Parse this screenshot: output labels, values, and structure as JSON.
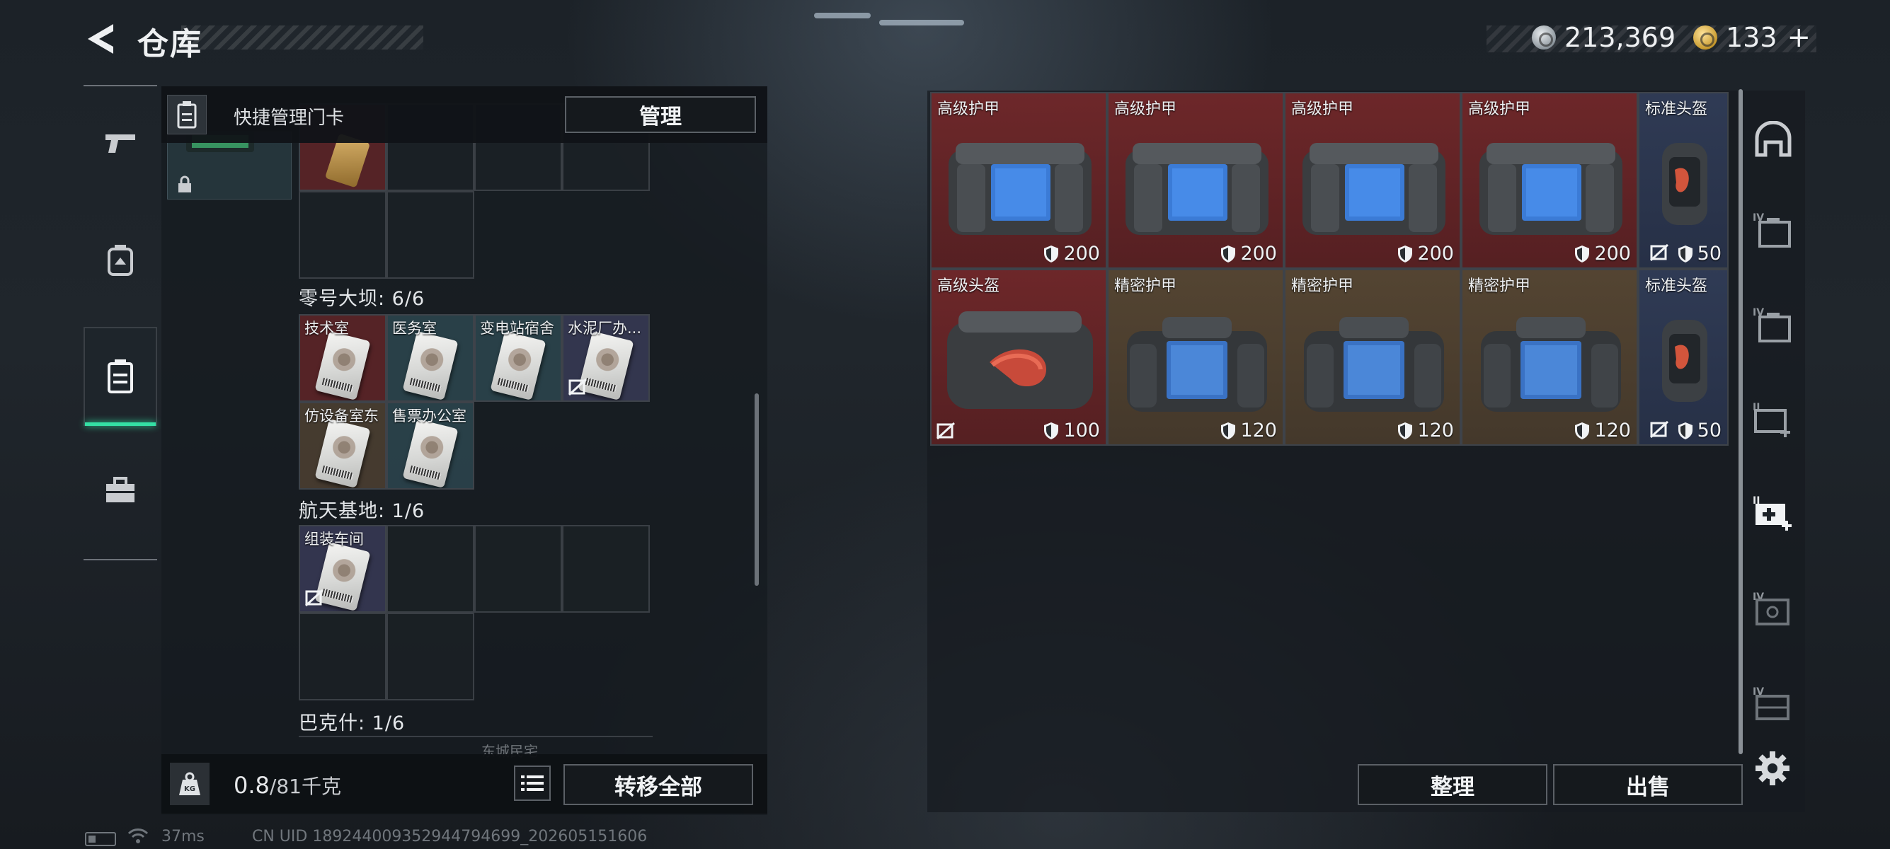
{
  "header": {
    "title": "仓库",
    "currency_silver": "213,369",
    "currency_gold": "133",
    "currency_gold_plus": "+"
  },
  "left_rail": {
    "items": [
      {
        "icon": "pistol-icon"
      },
      {
        "icon": "backpack-icon"
      },
      {
        "icon": "keycard-holder-icon",
        "active": true
      },
      {
        "icon": "toolbox-icon"
      }
    ],
    "accent": "#34e0a4"
  },
  "keycards": {
    "header_label": "快捷管理门卡",
    "manage_label": "管理",
    "sections": [
      {
        "title": "零号大坝: 6/6",
        "cards": [
          {
            "name": "技术室",
            "color": "red",
            "bound": false
          },
          {
            "name": "医务室",
            "color": "teal",
            "bound": false
          },
          {
            "name": "变电站宿舍",
            "color": "teal",
            "bound": false
          },
          {
            "name": "水泥厂办...",
            "color": "purple",
            "bound": true
          },
          {
            "name": "仿设备室东",
            "color": "brown",
            "bound": false
          },
          {
            "name": "售票办公室",
            "color": "teal",
            "bound": false
          }
        ]
      },
      {
        "title": "航天基地: 1/6",
        "cards": [
          {
            "name": "组装车间",
            "color": "purple",
            "bound": true
          }
        ]
      },
      {
        "title": "巴克什: 1/6",
        "cards": []
      }
    ],
    "next_section_peek": "东城民宅",
    "weight_current": "0.8",
    "weight_max": "/81千克",
    "transfer_all_label": "转移全部"
  },
  "stash": {
    "items": [
      {
        "name": "高级护甲",
        "value": "200",
        "rarity": "red",
        "type": "armor",
        "bound": false
      },
      {
        "name": "高级护甲",
        "value": "200",
        "rarity": "red",
        "type": "armor",
        "bound": false
      },
      {
        "name": "高级护甲",
        "value": "200",
        "rarity": "red",
        "type": "armor",
        "bound": false
      },
      {
        "name": "高级护甲",
        "value": "200",
        "rarity": "red",
        "type": "armor",
        "bound": false
      },
      {
        "name": "标准头盔",
        "value": "50",
        "rarity": "blue",
        "type": "helmet",
        "bound": true
      },
      {
        "name": "高级头盔",
        "value": "100",
        "rarity": "red",
        "type": "helmet-wide",
        "bound": true
      },
      {
        "name": "精密护甲",
        "value": "120",
        "rarity": "brown",
        "type": "armor",
        "bound": false
      },
      {
        "name": "精密护甲",
        "value": "120",
        "rarity": "brown",
        "type": "armor",
        "bound": false
      },
      {
        "name": "精密护甲",
        "value": "120",
        "rarity": "brown",
        "type": "armor",
        "bound": false
      },
      {
        "name": "标准头盔",
        "value": "50",
        "rarity": "blue",
        "type": "helmet",
        "bound": true
      }
    ],
    "sort_label": "整理",
    "sell_label": "出售"
  },
  "right_rail": {
    "items": [
      {
        "icon": "helmet-slot-icon",
        "tier": ""
      },
      {
        "icon": "folder-case-icon",
        "tier": "IV"
      },
      {
        "icon": "folder-case-icon",
        "tier": "IV"
      },
      {
        "icon": "medkit-add-icon",
        "tier": "II"
      },
      {
        "icon": "medkit-add-icon",
        "tier": "II",
        "active": true
      },
      {
        "icon": "safe-box-icon",
        "tier": "IV"
      },
      {
        "icon": "crate-icon",
        "tier": "IV"
      }
    ],
    "settings_icon": "gear-icon"
  },
  "status_bar": {
    "ping": "37ms",
    "uid": "CN UID 1892440093529447946​99_202605151606"
  }
}
